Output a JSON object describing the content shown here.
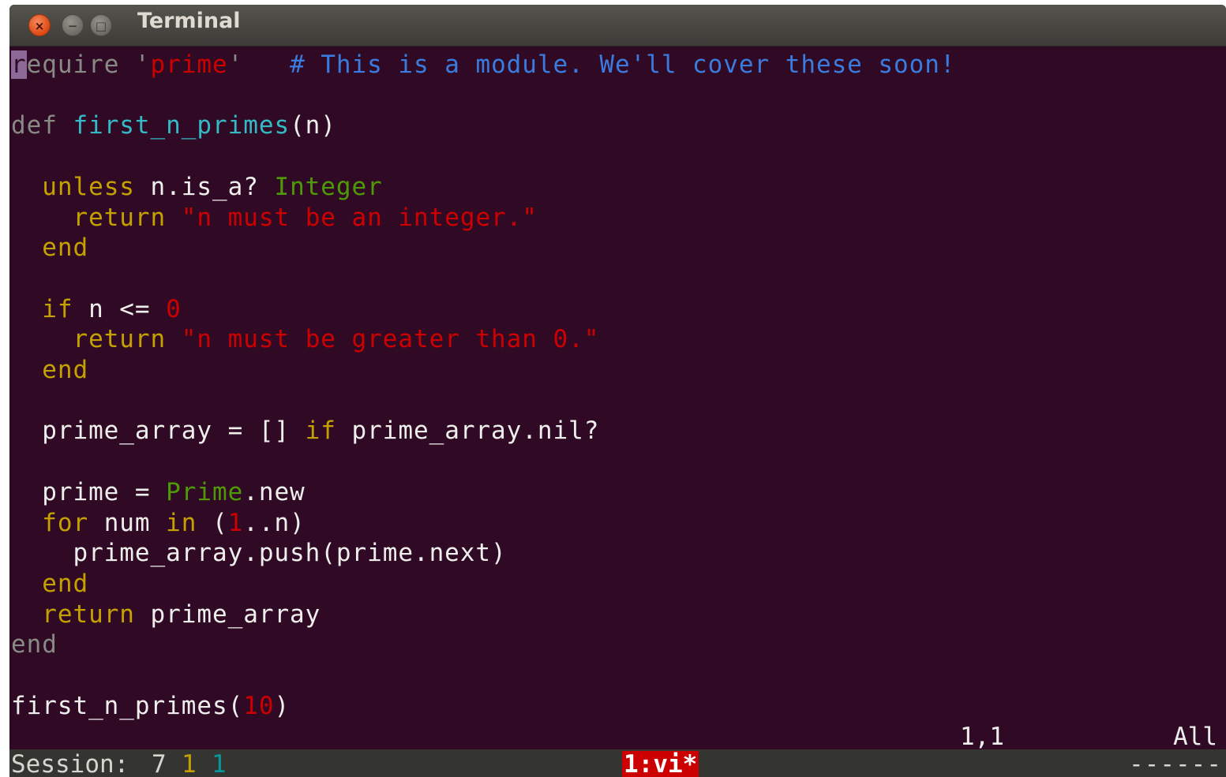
{
  "window": {
    "title": "Terminal",
    "close_glyph": "×",
    "minimize_glyph": "−",
    "maximize_glyph": "□"
  },
  "editor": {
    "lines": [
      [
        {
          "t": "r",
          "c": "cursor"
        },
        {
          "t": "equire ",
          "c": "dkw"
        },
        {
          "t": "'",
          "c": "dkw"
        },
        {
          "t": "prime",
          "c": "str"
        },
        {
          "t": "'",
          "c": "dkw"
        },
        {
          "t": "   # This is a module. We'll cover these soon!",
          "c": "cmt"
        }
      ],
      [],
      [
        {
          "t": "def ",
          "c": "dkw"
        },
        {
          "t": "first_n_primes",
          "c": "fn"
        },
        {
          "t": "(n)",
          "c": "plain"
        }
      ],
      [],
      [
        {
          "t": "  ",
          "c": "plain"
        },
        {
          "t": "unless",
          "c": "kw"
        },
        {
          "t": " n.is_a? ",
          "c": "plain"
        },
        {
          "t": "Integer",
          "c": "cls"
        }
      ],
      [
        {
          "t": "    ",
          "c": "plain"
        },
        {
          "t": "return",
          "c": "kw"
        },
        {
          "t": " ",
          "c": "plain"
        },
        {
          "t": "\"n must be an integer.\"",
          "c": "str"
        }
      ],
      [
        {
          "t": "  ",
          "c": "plain"
        },
        {
          "t": "end",
          "c": "kw"
        }
      ],
      [],
      [
        {
          "t": "  ",
          "c": "plain"
        },
        {
          "t": "if",
          "c": "kw"
        },
        {
          "t": " n <= ",
          "c": "plain"
        },
        {
          "t": "0",
          "c": "num"
        }
      ],
      [
        {
          "t": "    ",
          "c": "plain"
        },
        {
          "t": "return",
          "c": "kw"
        },
        {
          "t": " ",
          "c": "plain"
        },
        {
          "t": "\"n must be greater than 0.\"",
          "c": "str"
        }
      ],
      [
        {
          "t": "  ",
          "c": "plain"
        },
        {
          "t": "end",
          "c": "kw"
        }
      ],
      [],
      [
        {
          "t": "  prime_array = [] ",
          "c": "plain"
        },
        {
          "t": "if",
          "c": "kw"
        },
        {
          "t": " prime_array.nil?",
          "c": "plain"
        }
      ],
      [],
      [
        {
          "t": "  prime = ",
          "c": "plain"
        },
        {
          "t": "Prime",
          "c": "cls"
        },
        {
          "t": ".new",
          "c": "plain"
        }
      ],
      [
        {
          "t": "  ",
          "c": "plain"
        },
        {
          "t": "for",
          "c": "kw"
        },
        {
          "t": " num ",
          "c": "plain"
        },
        {
          "t": "in",
          "c": "kw"
        },
        {
          "t": " (",
          "c": "plain"
        },
        {
          "t": "1",
          "c": "num"
        },
        {
          "t": "..n)",
          "c": "plain"
        }
      ],
      [
        {
          "t": "    prime_array.push(prime.next)",
          "c": "plain"
        }
      ],
      [
        {
          "t": "  ",
          "c": "plain"
        },
        {
          "t": "end",
          "c": "kw"
        }
      ],
      [
        {
          "t": "  ",
          "c": "plain"
        },
        {
          "t": "return",
          "c": "kw"
        },
        {
          "t": " prime_array",
          "c": "plain"
        }
      ],
      [
        {
          "t": "end",
          "c": "dkw"
        }
      ],
      [],
      [
        {
          "t": "first_n_primes(",
          "c": "plain"
        },
        {
          "t": "10",
          "c": "num"
        },
        {
          "t": ")",
          "c": "plain"
        }
      ]
    ],
    "ruler": {
      "position": "1,1",
      "percent": "All"
    }
  },
  "statusbar": {
    "session_label": "Session:",
    "n1": "7",
    "n2": "1",
    "n3": "1",
    "window_label": "1:vi*",
    "dashes": "-------"
  },
  "colors": {
    "terminal_bg": "#300a24",
    "keyword": "#c4a000",
    "string": "#cc0000",
    "comment": "#3a7be0",
    "function": "#34b9c6",
    "constant": "#4e9a06",
    "status_window_bg": "#cc0000"
  }
}
